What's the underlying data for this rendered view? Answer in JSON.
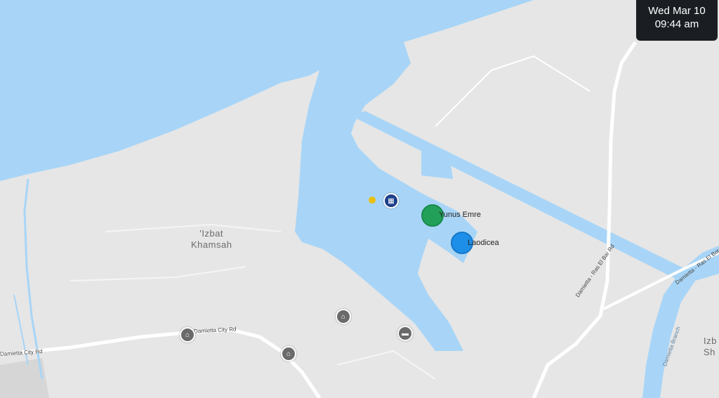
{
  "clock": {
    "date": "Wed Mar 10",
    "time": "09:44 am"
  },
  "places": {
    "area_1": "'Izbat",
    "area_2": "Khamsah",
    "izb_fragment_1": "Izb",
    "izb_fragment_2": "Sh"
  },
  "roads": {
    "city_rd_left": "Damietta City Rd",
    "city_rd_mid": "Damietta City Rd",
    "ras_el_bar_1": "Damietta - Ras El Bar Rd",
    "ras_el_bar_2": "Damietta - Ras El Bar",
    "branch": "Damietta Branch"
  },
  "vessels": [
    {
      "name": "Yunus Emre",
      "color": "#22a05a"
    },
    {
      "name": "Laodicea",
      "color": "#1e8fe8"
    }
  ],
  "colors": {
    "water": "#a8d5f7",
    "land": "#e6e6e6",
    "road": "#ffffff"
  }
}
